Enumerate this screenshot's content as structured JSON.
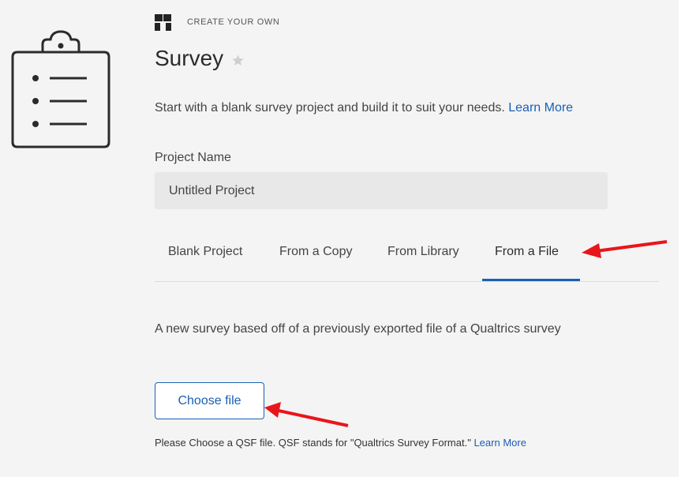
{
  "header": {
    "brand_label": "CREATE YOUR OWN",
    "title": "Survey",
    "description": "Start with a blank survey project and build it to suit your needs.",
    "learn_more": "Learn More"
  },
  "project_name": {
    "label": "Project Name",
    "value": "Untitled Project"
  },
  "tabs": [
    {
      "label": "Blank Project",
      "active": false
    },
    {
      "label": "From a Copy",
      "active": false
    },
    {
      "label": "From Library",
      "active": false
    },
    {
      "label": "From a File",
      "active": true
    }
  ],
  "file_section": {
    "info": "A new survey based off of a previously exported file of a Qualtrics survey",
    "button_label": "Choose file",
    "note": "Please Choose a QSF file. QSF stands for \"Qualtrics Survey Format.\"",
    "note_link": "Learn More"
  },
  "colors": {
    "accent": "#1a5fb4",
    "annotation_arrow": "#e8161b",
    "panel_bg": "#f4f4f4"
  }
}
